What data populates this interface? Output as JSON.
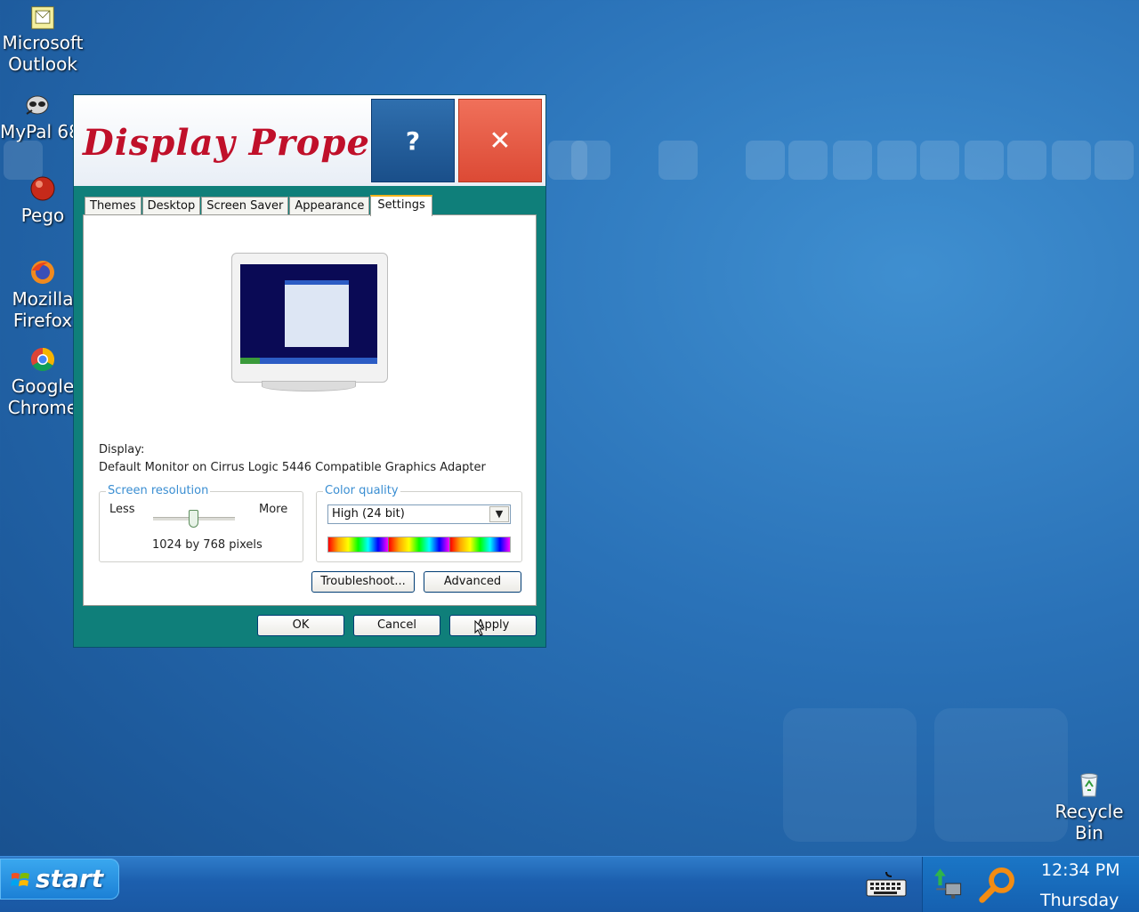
{
  "desktop": {
    "icons": [
      {
        "label": "Microsoft\nOutlook",
        "icon": "outlook-icon"
      },
      {
        "label": "MyPal 68",
        "icon": "mypal-icon"
      },
      {
        "label": "Pego",
        "icon": "pego-icon"
      },
      {
        "label": "Mozilla\nFirefox",
        "icon": "firefox-icon"
      },
      {
        "label": "Google\nChrome",
        "icon": "chrome-icon"
      },
      {
        "label": "Recycle\nBin",
        "icon": "recycle-bin-icon"
      }
    ]
  },
  "dialog": {
    "title": "Display Prope...",
    "help_label": "?",
    "close_label": "✕",
    "tabs": [
      "Themes",
      "Desktop",
      "Screen Saver",
      "Appearance",
      "Settings"
    ],
    "active_tab": "Settings",
    "display_label": "Display:",
    "display_value": "Default Monitor on Cirrus Logic 5446 Compatible Graphics Adapter",
    "resolution": {
      "legend": "Screen resolution",
      "less": "Less",
      "more": "More",
      "value": "1024 by 768 pixels",
      "slider_fraction": 0.5
    },
    "color_quality": {
      "legend": "Color quality",
      "selected": "High (24 bit)"
    },
    "buttons": {
      "troubleshoot": "Troubleshoot...",
      "advanced": "Advanced",
      "ok": "OK",
      "cancel": "Cancel",
      "apply": "Apply"
    }
  },
  "taskbar": {
    "start_label": "start",
    "tray_icons": [
      "keyboard-icon",
      "network-icon",
      "search-icon"
    ],
    "time": "12:34 PM",
    "day": "Thursday"
  }
}
